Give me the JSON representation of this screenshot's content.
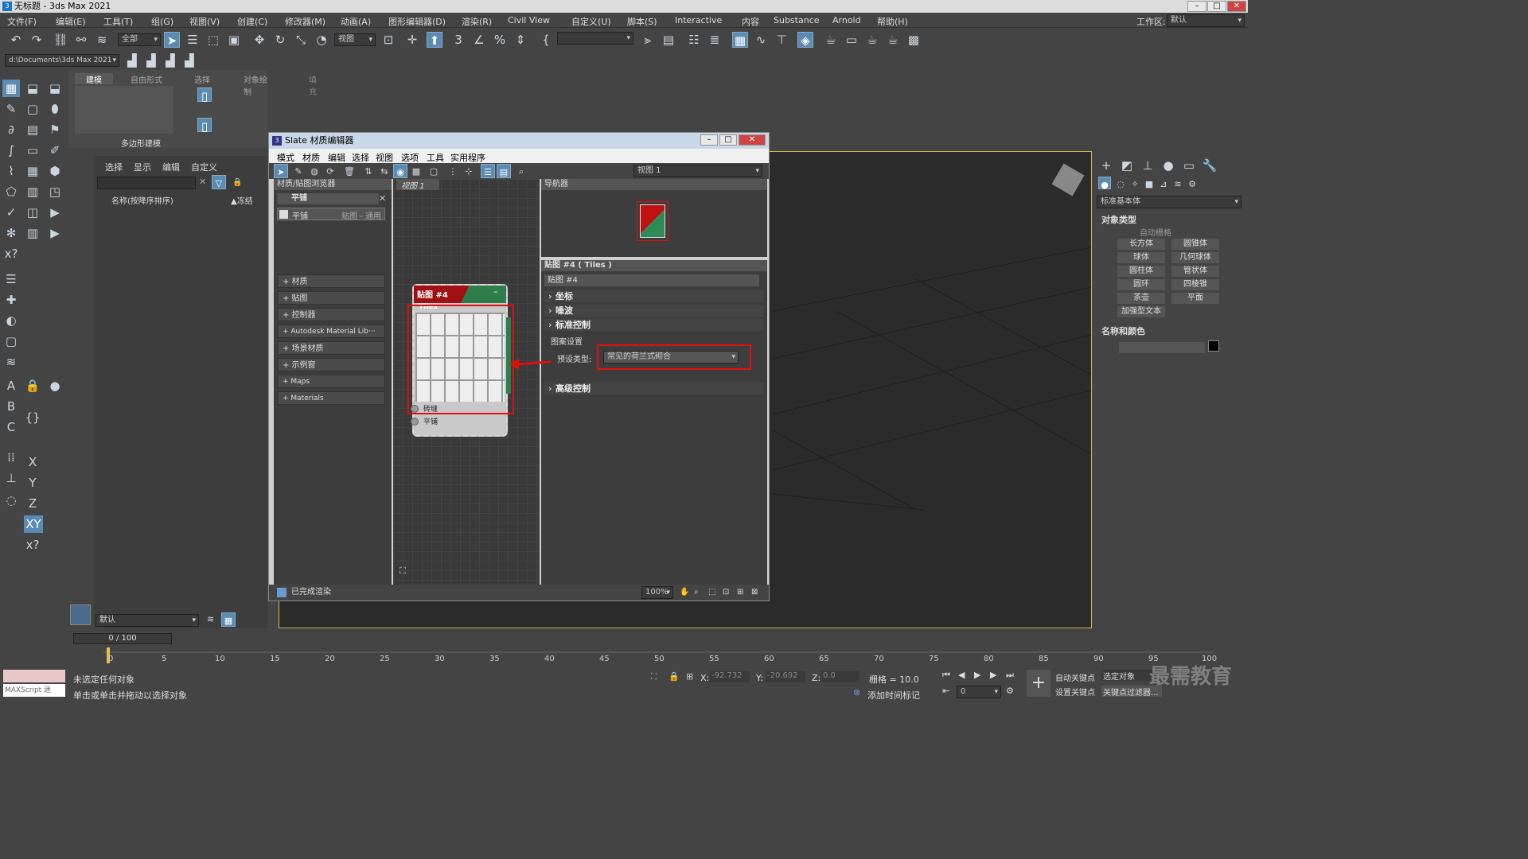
{
  "app": {
    "title": "无标题 - 3ds Max 2021",
    "workspace_label": "工作区:",
    "workspace_value": "默认"
  },
  "menus": [
    "文件(F)",
    "编辑(E)",
    "工具(T)",
    "组(G)",
    "视图(V)",
    "创建(C)",
    "修改器(M)",
    "动画(A)",
    "图形编辑器(D)",
    "渲染(R)",
    "Civil View",
    "自定义(U)",
    "脚本(S)",
    "Interactive",
    "内容",
    "Substance",
    "Arnold",
    "帮助(H)"
  ],
  "toolbar": {
    "filter": "全部",
    "refsys": "视图",
    "path": "d:\\Documents\\3ds Max 2021"
  },
  "ribbon": {
    "tabs": [
      "建模",
      "自由形式",
      "选择",
      "对象绘制",
      "填充"
    ],
    "group_label": "多边形建模"
  },
  "scene": {
    "tabs": [
      "选择",
      "显示",
      "编辑",
      "自定义"
    ],
    "col_name": "名称(按降序排序)",
    "col_frozen": "▲冻结"
  },
  "slate": {
    "title": "Slate 材质编辑器",
    "menus": [
      "模式",
      "材质",
      "编辑",
      "选择",
      "视图",
      "选项",
      "工具",
      "实用程序"
    ],
    "view_dropdown": "视图 1",
    "view_tab": "视图 1",
    "browser": {
      "header": "材质/贴图浏览器",
      "search_group": "平铺",
      "result": "平铺",
      "result_type": "贴图 - 通用",
      "sections": [
        "+ 材质",
        "+ 贴图",
        "+ 控制器",
        "+ Autodesk Material Lib···",
        "+ 场景材质",
        "+ 示例窗",
        "+ Maps",
        "+ Materials"
      ]
    },
    "node": {
      "title": "贴图 #4",
      "subtitle": "Tiles",
      "slot1": "砖缝",
      "slot2": "平铺"
    },
    "navigator": "导航器",
    "params": {
      "header": "贴图 #4 ( Tiles )",
      "name_field": "贴图 #4",
      "rollouts": [
        "坐标",
        "噪波",
        "标准控制",
        "高级控制"
      ],
      "group": "图案设置",
      "preset_label": "预设类型:",
      "preset_value": "常见的荷兰式砌合"
    },
    "status": "已完成渲染",
    "zoom": "100%"
  },
  "right": {
    "category": "标准基本体",
    "obj_type": "对象类型",
    "autogrid": "自动栅格",
    "buttons": [
      "长方体",
      "圆锥体",
      "球体",
      "几何球体",
      "圆柱体",
      "管状体",
      "圆环",
      "四棱锥",
      "茶壶",
      "平面",
      "加强型文本"
    ],
    "name_color": "名称和颜色"
  },
  "bottom": {
    "layer": "默认",
    "frame": "0 / 100",
    "status1": "未选定任何对象",
    "status2": "单击或单击并拖动以选择对象",
    "script": "MAXScript 迷",
    "x_label": "X:",
    "x": "-92.732",
    "y_label": "Y:",
    "y": "-20.692",
    "z_label": "Z:",
    "z": "0.0",
    "grid": "栅格 = 10.0",
    "add_time": "添加时间标记",
    "autokey": "自动关键点",
    "setkey": "设置关键点",
    "selected": "选定对象",
    "keyfilter": "关键点过滤器...",
    "frame_field": "0",
    "ticks": [
      "0",
      "5",
      "10",
      "15",
      "20",
      "25",
      "30",
      "35",
      "40",
      "45",
      "50",
      "55",
      "60",
      "65",
      "70",
      "75",
      "80",
      "85",
      "90",
      "95",
      "100"
    ]
  },
  "watermark": "最需教育"
}
